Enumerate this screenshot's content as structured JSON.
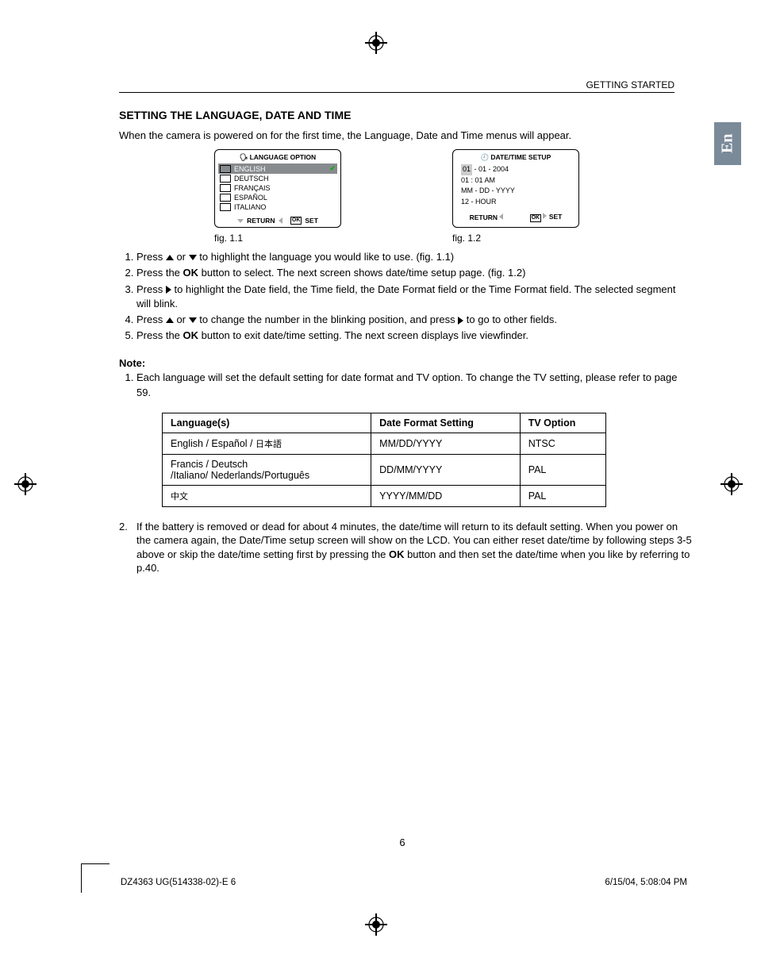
{
  "header": {
    "section": "GETTING STARTED"
  },
  "tab": "En",
  "title": "SETTING THE LANGUAGE, DATE AND TIME",
  "intro": "When the camera is powered on for the first time, the Language, Date and Time menus will appear.",
  "lang_screen": {
    "title": "LANGUAGE  OPTION",
    "items": [
      "ENGLISH",
      "DEUTSCH",
      "FRANÇAIS",
      "ESPAÑOL",
      "ITALIANO"
    ],
    "footer_return": "RETURN",
    "footer_set": "SET",
    "ok": "OK",
    "caption": "fig. 1.1"
  },
  "dt_screen": {
    "title": "DATE/TIME SETUP",
    "line1_pre": "01",
    "line1_rest": " - 01 - 2004",
    "line2": "01 : 01 AM",
    "line3": "MM - DD - YYYY",
    "line4": "12 - HOUR",
    "footer_return": "RETURN",
    "footer_set": "SET",
    "ok": "OK",
    "caption": "fig. 1.2"
  },
  "steps": {
    "s1a": "Press ",
    "s1b": " or ",
    "s1c": " to highlight the language you would like to use. (fig. 1.1)",
    "s2a": "Press the ",
    "s2ok": "OK",
    "s2b": " button to select. The next screen shows date/time setup page. (fig. 1.2)",
    "s3a": "Press ",
    "s3b": " to highlight the Date field, the Time field, the Date Format field or the Time Format field. The selected segment will blink.",
    "s4a": "Press ",
    "s4b": " or ",
    "s4c": " to change the number in the blinking position, and press ",
    "s4d": " to go to other fields.",
    "s5a": "Press the ",
    "s5ok": "OK",
    "s5b": " button to exit date/time setting. The next screen displays live viewfinder."
  },
  "note_label": "Note:",
  "note1": "Each language will set the default setting for date format and TV option. To change the TV setting, please refer to page 59.",
  "table": {
    "head": {
      "c1": "Language(s)",
      "c2": "Date Format Setting",
      "c3": "TV Option"
    },
    "rows": [
      {
        "c1a": "English / Español / ",
        "c1b": "日本語",
        "c2": "MM/DD/YYYY",
        "c3": "NTSC"
      },
      {
        "c1": "Francis / Deutsch\n/Italiano/ Nederlands/Português",
        "c2": "DD/MM/YYYY",
        "c3": "PAL"
      },
      {
        "c1b": "中文",
        "c2": "YYYY/MM/DD",
        "c3": "PAL"
      }
    ]
  },
  "note2a": "If the battery is removed or dead for about 4 minutes, the date/time will return to its default setting. When you power on the camera again, the Date/Time setup screen will show on the LCD. You can either reset date/time by following steps 3-5 above or skip the date/time setting first by pressing the ",
  "note2ok": "OK",
  "note2b": " button and then set the date/time when you like by referring to p.40.",
  "pagenum": "6",
  "footer": {
    "left": "DZ4363 UG(514338-02)-E   6",
    "right": "6/15/04, 5:08:04 PM"
  },
  "chart_data": {
    "type": "table",
    "title": "Language default settings",
    "columns": [
      "Language(s)",
      "Date Format Setting",
      "TV Option"
    ],
    "rows": [
      [
        "English / Español / 日本語",
        "MM/DD/YYYY",
        "NTSC"
      ],
      [
        "Francis / Deutsch /Italiano/ Nederlands/Português",
        "DD/MM/YYYY",
        "PAL"
      ],
      [
        "中文",
        "YYYY/MM/DD",
        "PAL"
      ]
    ]
  }
}
